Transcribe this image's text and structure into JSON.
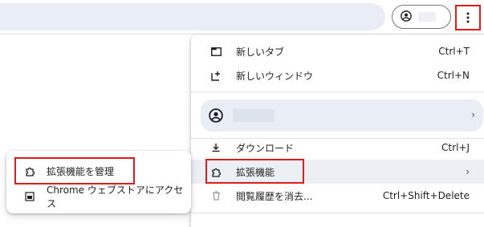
{
  "toolbar": {
    "profile_icon": "account-circle-icon",
    "menu_icon": "more-vert-icon"
  },
  "menu": {
    "new_tab": {
      "label": "新しいタブ",
      "shortcut": "Ctrl+T",
      "icon": "new-tab-icon"
    },
    "new_window": {
      "label": "新しいウィンドウ",
      "shortcut": "Ctrl+N",
      "icon": "new-window-icon"
    },
    "profile": {
      "icon": "account-circle-icon",
      "chevron": "›"
    },
    "downloads": {
      "label": "ダウンロード",
      "shortcut": "Ctrl+J",
      "icon": "download-icon"
    },
    "extensions": {
      "label": "拡張機能",
      "chevron": "›",
      "icon": "extension-icon"
    },
    "clear_history": {
      "label": "閲覧履歴を消去...",
      "shortcut": "Ctrl+Shift+Delete",
      "icon": "trash-icon"
    }
  },
  "submenu": {
    "manage_extensions": {
      "label": "拡張機能を管理",
      "icon": "extension-icon"
    },
    "web_store": {
      "label": "Chrome ウェブストアにアクセス",
      "icon": "web-store-icon"
    }
  },
  "colors": {
    "highlight_border": "#e01b1b",
    "menu_bg": "#ffffff",
    "profile_bg": "#e9eef6"
  }
}
